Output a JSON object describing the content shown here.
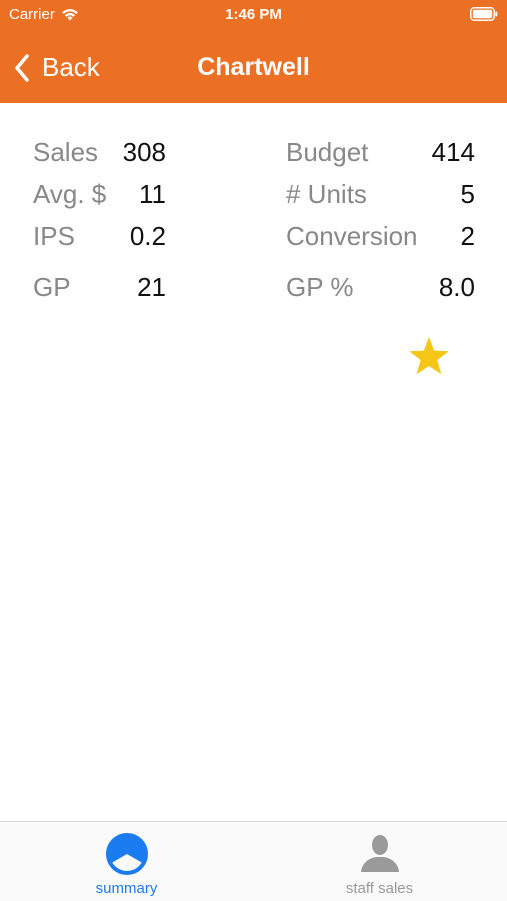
{
  "status_bar": {
    "carrier": "Carrier",
    "time": "1:46 PM"
  },
  "nav": {
    "back_label": "Back",
    "title": "Chartwell"
  },
  "metrics": {
    "sales": {
      "label": "Sales",
      "value": "308"
    },
    "avg": {
      "label": "Avg. $",
      "value": "11"
    },
    "ips": {
      "label": "IPS",
      "value": "0.2"
    },
    "gp": {
      "label": "GP",
      "value": "21"
    },
    "budget": {
      "label": "Budget",
      "value": "414"
    },
    "units": {
      "label": "# Units",
      "value": "5"
    },
    "conversion": {
      "label": "Conversion",
      "value": "2"
    },
    "gp_pct": {
      "label": "GP %",
      "value": "8.0"
    }
  },
  "tabs": {
    "summary": {
      "label": "summary",
      "icon": "pie-chart-icon",
      "color": "#1a7cf0"
    },
    "staff": {
      "label": "staff sales",
      "icon": "person-icon",
      "color": "#9a9a9a"
    }
  },
  "colors": {
    "brand": "#ec7024",
    "star": "#f5c518"
  },
  "star_icon": "star-icon"
}
